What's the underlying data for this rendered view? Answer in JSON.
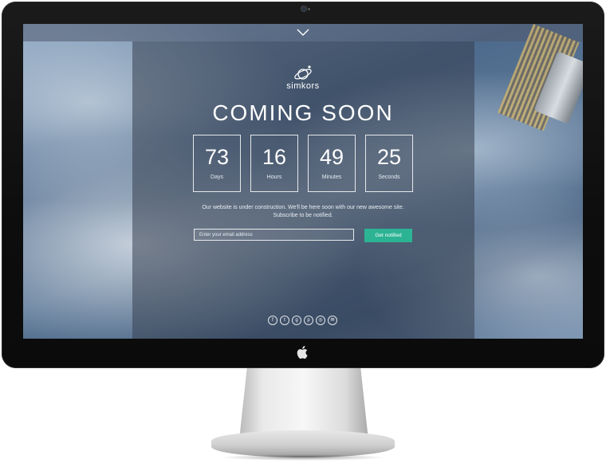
{
  "page": {
    "brand": "simkors",
    "title": "COMING SOON",
    "countdown": [
      {
        "value": "73",
        "label": "Days"
      },
      {
        "value": "16",
        "label": "Hours"
      },
      {
        "value": "49",
        "label": "Minutes"
      },
      {
        "value": "25",
        "label": "Seconds"
      }
    ],
    "message": "Our website is under construction. We'll be here soon with our new awesome site. Subscribe to be notified.",
    "email_placeholder": "Enter your email address",
    "notify_label": "Get notified",
    "accent_color": "#2bb393",
    "socials": [
      {
        "icon": "facebook-icon",
        "glyph": "f"
      },
      {
        "icon": "twitter-icon",
        "glyph": "t"
      },
      {
        "icon": "google-plus-icon",
        "glyph": "g"
      },
      {
        "icon": "pinterest-icon",
        "glyph": "p"
      },
      {
        "icon": "dribbble-icon",
        "glyph": "◎"
      },
      {
        "icon": "email-icon",
        "glyph": "✉"
      }
    ],
    "scroll_icon": "chevron-down-icon"
  },
  "device": {
    "logo_icon": "apple-logo-icon"
  }
}
